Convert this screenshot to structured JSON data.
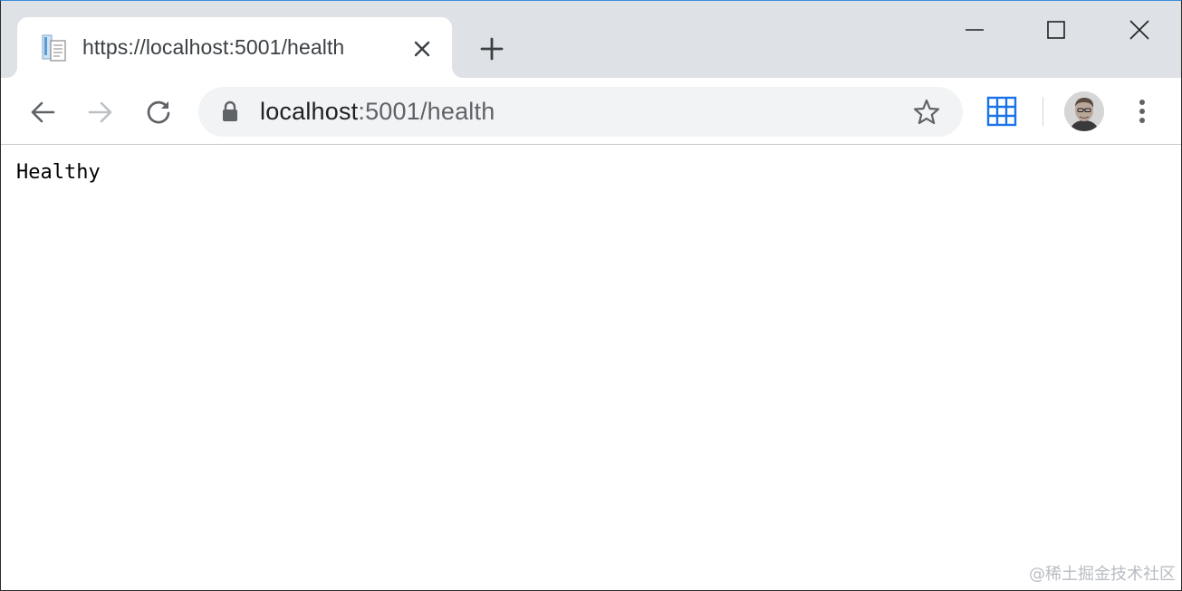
{
  "tab": {
    "title": "https://localhost:5001/health",
    "favicon": "document-icon"
  },
  "window_controls": {
    "minimize": "minimize-icon",
    "maximize": "maximize-icon",
    "close": "close-icon"
  },
  "toolbar": {
    "back": "arrow-left-icon",
    "forward": "arrow-right-icon",
    "reload": "reload-icon"
  },
  "omnibox": {
    "host": "localhost",
    "path": ":5001/health",
    "lock": "lock-icon",
    "star": "star-icon"
  },
  "extensions": {
    "apps": "apps-grid-icon",
    "avatar": "profile-avatar",
    "menu": "more-vertical-icon"
  },
  "page": {
    "body_text": "Healthy"
  },
  "watermark": "@稀土掘金技术社区",
  "colors": {
    "tabstrip": "#dee1e6",
    "omnibox_bg": "#f1f3f4",
    "apps_blue": "#1a73e8",
    "forward_disabled": "#bdc1c6",
    "icon": "#5f6368"
  }
}
